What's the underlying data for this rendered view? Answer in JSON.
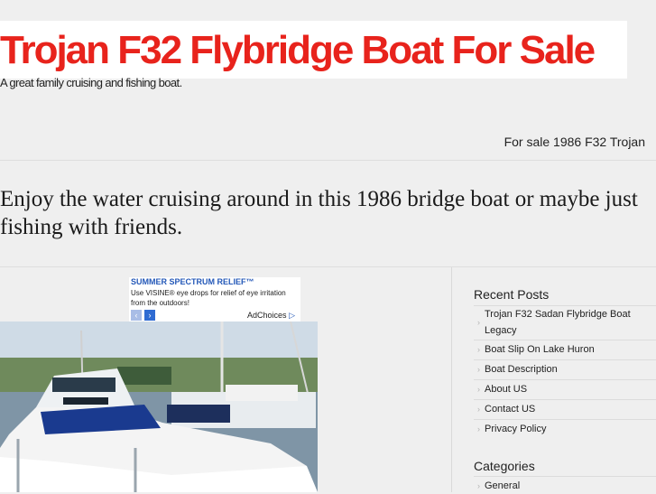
{
  "site": {
    "title": "Trojan F32 Flybridge Boat For Sale",
    "tagline": "A great family cruising and fishing boat."
  },
  "nav": {
    "page_link": "For sale 1986 F32 Trojan"
  },
  "main": {
    "headline": "Enjoy the water cruising around in this 1986 bridge boat or maybe just fishing with friends."
  },
  "ad": {
    "title": "SUMMER SPECTRUM RELIEF™",
    "text": "Use VISINE® eye drops for relief of eye irritation from the outdoors!",
    "prev_icon": "chevron-left-icon",
    "next_icon": "chevron-right-icon",
    "choices_label": "AdChoices"
  },
  "sidebar": {
    "recent_heading": "Recent Posts",
    "recent_posts": [
      "Trojan F32 Sadan Flybridge Boat Legacy",
      "Boat Slip On Lake Huron",
      "Boat Description",
      "About US",
      "Contact US",
      "Privacy Policy"
    ],
    "categories_heading": "Categories",
    "categories": [
      "General"
    ],
    "bullet": "›"
  },
  "colors": {
    "title": "#e8231c",
    "background": "#efefef",
    "ad_link": "#2458b8"
  }
}
